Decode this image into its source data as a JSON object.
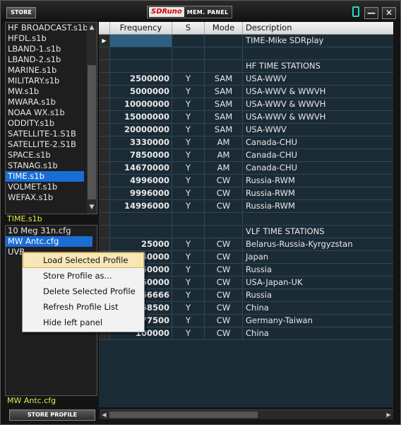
{
  "header": {
    "store_label": "STORE",
    "logo_brand": "SDRuno",
    "logo_text": "MEM. PANEL",
    "digit": "0",
    "min_glyph": "—",
    "close_glyph": "✕"
  },
  "left_panel": {
    "files": [
      "HF BROADCAST.s1b",
      "HFDL.s1b",
      "LBAND-1.s1b",
      "LBAND-2.s1b",
      "MARINE.s1b",
      "MILITARY.s1b",
      "MW.s1b",
      "MWARA.s1b",
      "NOAA WX.s1b",
      "ODDITY.s1b",
      "SATELLITE-1.S1B",
      "SATELLITE-2.S1B",
      "SPACE.s1b",
      "STANAG.s1b",
      "TIME.s1b",
      "VOLMET.s1b",
      "WEFAX.s1b"
    ],
    "selected_file": "TIME.s1b",
    "configs": [
      "10 Meg 31n.cfg",
      "MW Antc.cfg",
      "UVB"
    ],
    "selected_config": "MW Antc.cfg",
    "store_profile_label": "STORE PROFILE"
  },
  "table": {
    "columns": [
      "Frequency",
      "S",
      "Mode",
      "Description"
    ],
    "rows": [
      {
        "freq": "",
        "s": "",
        "mode": "",
        "desc": "TIME-Mike SDRplay"
      },
      {
        "freq": "",
        "s": "",
        "mode": "",
        "desc": ""
      },
      {
        "freq": "",
        "s": "",
        "mode": "",
        "desc": "HF TIME STATIONS"
      },
      {
        "freq": "2500000",
        "s": "Y",
        "mode": "SAM",
        "desc": "USA-WWV"
      },
      {
        "freq": "5000000",
        "s": "Y",
        "mode": "SAM",
        "desc": "USA-WWV & WWVH"
      },
      {
        "freq": "10000000",
        "s": "Y",
        "mode": "SAM",
        "desc": "USA-WWV & WWVH"
      },
      {
        "freq": "15000000",
        "s": "Y",
        "mode": "SAM",
        "desc": "USA-WWV & WWVH"
      },
      {
        "freq": "20000000",
        "s": "Y",
        "mode": "SAM",
        "desc": "USA-WWV"
      },
      {
        "freq": "3330000",
        "s": "Y",
        "mode": "AM",
        "desc": "Canada-CHU"
      },
      {
        "freq": "7850000",
        "s": "Y",
        "mode": "AM",
        "desc": "Canada-CHU"
      },
      {
        "freq": "14670000",
        "s": "Y",
        "mode": "AM",
        "desc": "Canada-CHU"
      },
      {
        "freq": "4996000",
        "s": "Y",
        "mode": "CW",
        "desc": "Russia-RWM"
      },
      {
        "freq": "9996000",
        "s": "Y",
        "mode": "CW",
        "desc": "Russia-RWM"
      },
      {
        "freq": "14996000",
        "s": "Y",
        "mode": "CW",
        "desc": "Russia-RWM"
      },
      {
        "freq": "",
        "s": "",
        "mode": "",
        "desc": ""
      },
      {
        "freq": "",
        "s": "",
        "mode": "",
        "desc": "VLF TIME STATIONS"
      },
      {
        "freq": "25000",
        "s": "Y",
        "mode": "CW",
        "desc": "Belarus-Russia-Kyrgyzstan"
      },
      {
        "freq": "40000",
        "s": "Y",
        "mode": "CW",
        "desc": "Japan"
      },
      {
        "freq": "50000",
        "s": "Y",
        "mode": "CW",
        "desc": "Russia"
      },
      {
        "freq": "60000",
        "s": "Y",
        "mode": "CW",
        "desc": "USA-Japan-UK"
      },
      {
        "freq": "66666",
        "s": "Y",
        "mode": "CW",
        "desc": "Russia"
      },
      {
        "freq": "68500",
        "s": "Y",
        "mode": "CW",
        "desc": "China"
      },
      {
        "freq": "77500",
        "s": "Y",
        "mode": "CW",
        "desc": "Germany-Taiwan"
      },
      {
        "freq": "100000",
        "s": "Y",
        "mode": "CW",
        "desc": "China"
      }
    ]
  },
  "context_menu": {
    "items": [
      "Load Selected Profile",
      "Store Profile as...",
      "Delete Selected Profile",
      "Refresh Profile List",
      "Hide left panel"
    ]
  }
}
